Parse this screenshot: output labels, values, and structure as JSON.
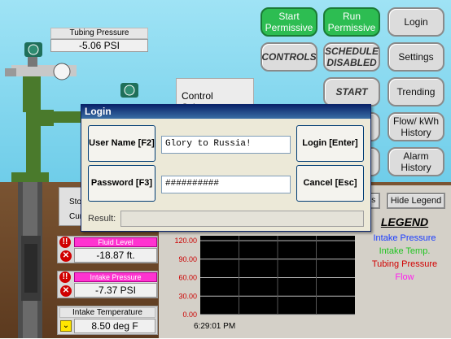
{
  "tubing_pressure": {
    "label": "Tubing Pressure",
    "value": "-5.06 PSI"
  },
  "control_scheme": {
    "label": "Control Scheme:"
  },
  "buttons": {
    "start_permissive": "Start Permissive",
    "run_permissive": "Run Permissive",
    "login": "Login",
    "controls": "CONTROLS",
    "schedule_disabled": "SCHEDULE DISABLED",
    "settings": "Settings",
    "start": "START",
    "trending": "Trending",
    "flow_history": "Flow/ kWh History",
    "alarm_history": "Alarm History"
  },
  "left_panel": {
    "stop_partial": "Sto",
    "current_partial": "Curr",
    "fluid_level": {
      "label": "Fluid Level",
      "value": "-18.87 ft."
    },
    "intake_pressure": {
      "label": "Intake Pressure",
      "value": "-7.37 PSI"
    },
    "intake_temperature": {
      "label": "Intake Temperature",
      "value": "8.50 deg F"
    }
  },
  "chart_controls": {
    "partial_button": "es",
    "hide_legend": "Hide Legend"
  },
  "legend": {
    "title": "LEGEND",
    "items": [
      {
        "name": "Intake Pressure",
        "color": "#1a3cff"
      },
      {
        "name": "Intake Temp.",
        "color": "#22c422"
      },
      {
        "name": "Tubing Pressure",
        "color": "#d10000"
      },
      {
        "name": "Flow",
        "color": "#ff22ee"
      }
    ]
  },
  "chart_data": {
    "type": "line",
    "y_ticks": [
      "120.00",
      "90.00",
      "60.00",
      "30.00",
      "0.00"
    ],
    "ylim": [
      0,
      120
    ],
    "x_label_time": "6:29:01 PM",
    "series": []
  },
  "dialog": {
    "title": "Login",
    "user_name_button": "User Name [F2]",
    "user_name_value": "Glory to Russia!",
    "password_button": "Password [F3]",
    "password_value": "##########",
    "login_button": "Login [Enter]",
    "cancel_button": "Cancel [Esc]",
    "result_label": "Result:",
    "result_value": ""
  }
}
